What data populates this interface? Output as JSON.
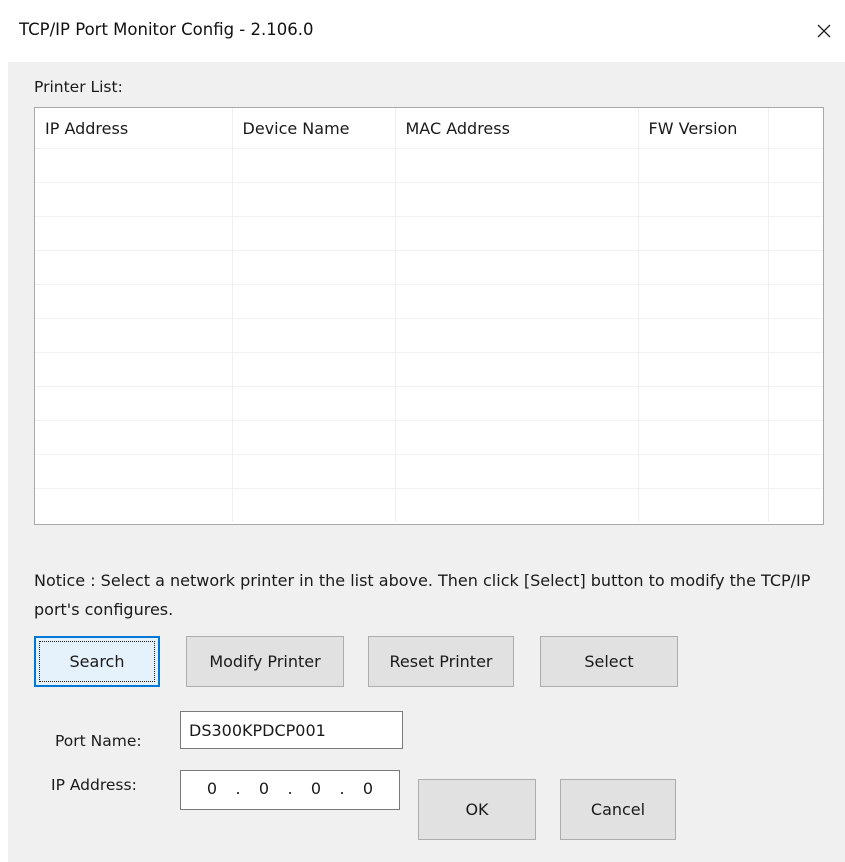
{
  "window": {
    "title": "TCP/IP Port Monitor Config - 2.106.0",
    "close_glyph": "✕"
  },
  "printer_list": {
    "label": "Printer List:",
    "columns": [
      "IP Address",
      "Device Name",
      "MAC Address",
      "FW Version",
      ""
    ],
    "rows": []
  },
  "notice": "Notice : Select a network printer in the list above. Then click [Select] button to modify the TCP/IP port's configures.",
  "buttons": {
    "search": "Search",
    "modify_printer": "Modify Printer",
    "reset_printer": "Reset Printer",
    "select": "Select",
    "ok": "OK",
    "cancel": "Cancel"
  },
  "port_name": {
    "label": "Port Name:",
    "value": "DS300KPDCP001"
  },
  "ip_address": {
    "label": "IP Address:",
    "octets": [
      "0",
      "0",
      "0",
      "0"
    ],
    "separator": "."
  },
  "icons": {
    "close": "close-icon"
  },
  "colors": {
    "dialog_background": "#f0f0f0",
    "button_face": "#e1e1e1",
    "default_button_border": "#0078d7",
    "default_button_face": "#e5f1fb"
  }
}
